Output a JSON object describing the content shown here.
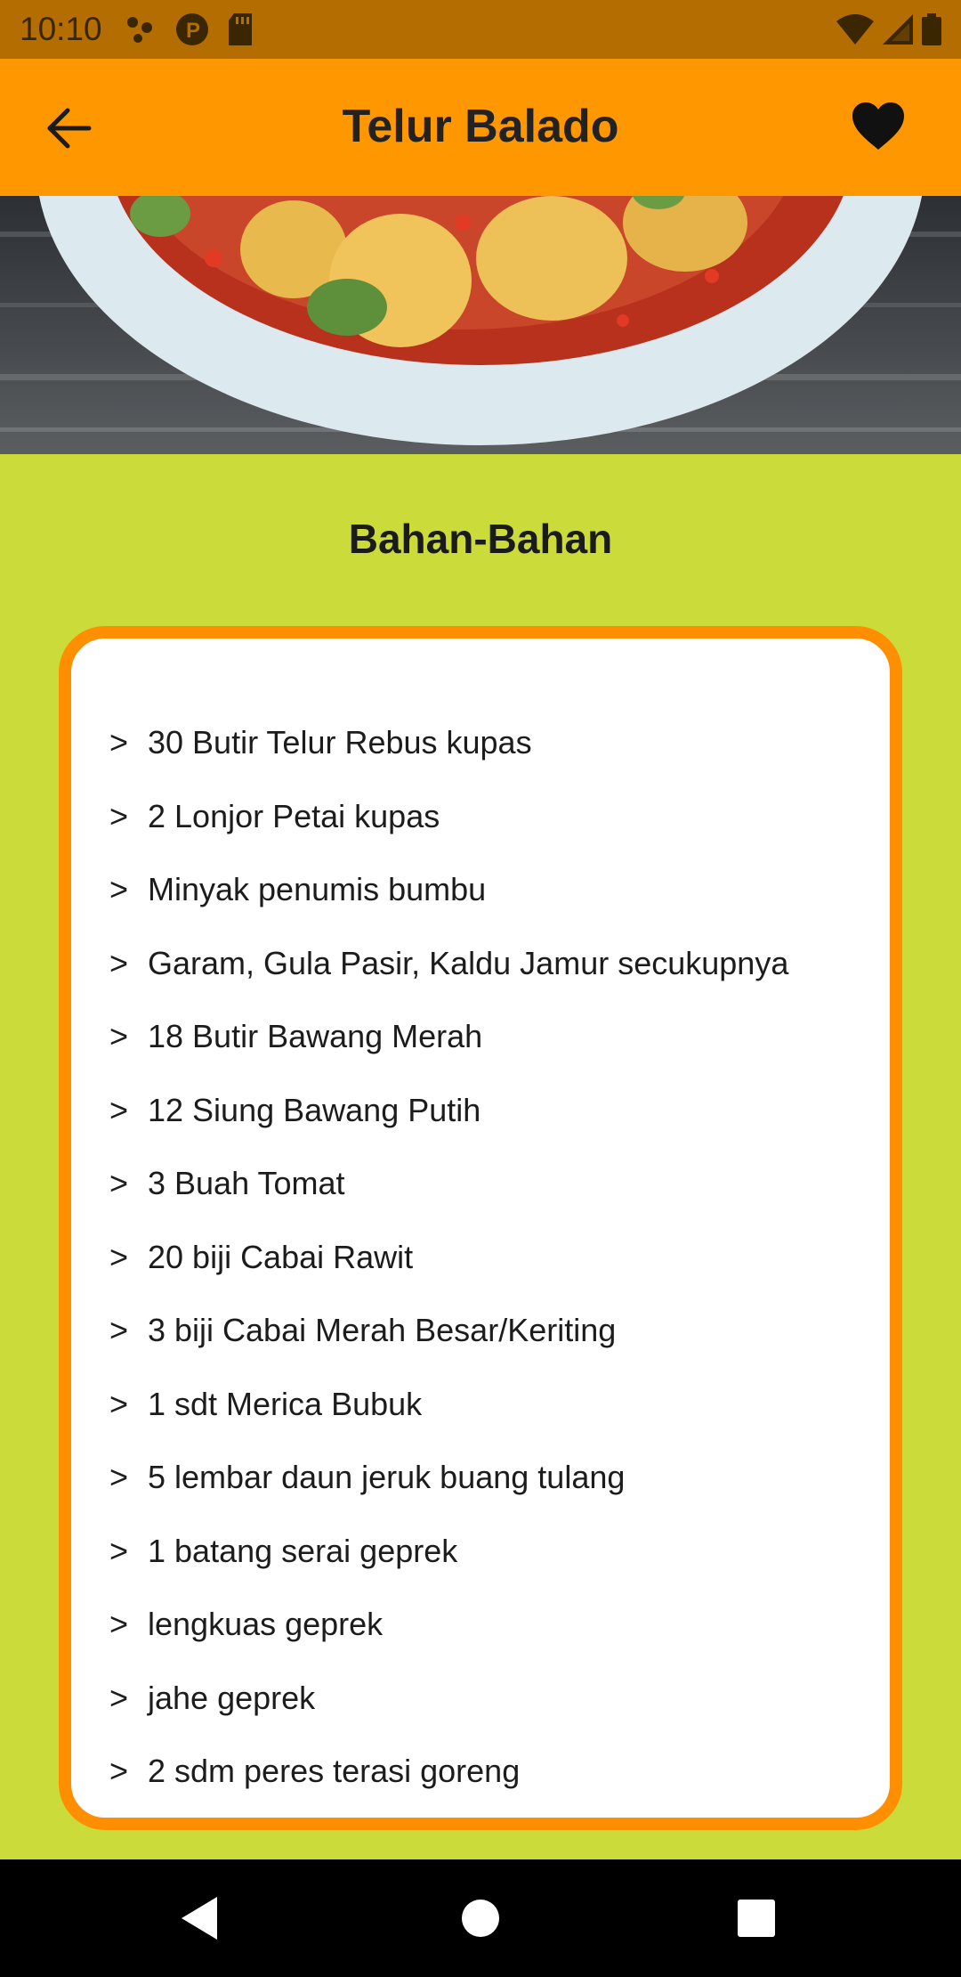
{
  "status_bar": {
    "time": "10:10",
    "left_icons": [
      "connection-dots-icon",
      "p-circle-icon",
      "sd-card-icon"
    ],
    "right_icons": [
      "wifi-icon",
      "cell-signal-icon",
      "battery-icon"
    ]
  },
  "app_bar": {
    "title": "Telur Balado",
    "back_icon": "arrow-left-icon",
    "favorite_icon": "heart-icon"
  },
  "hero_image": {
    "description_icon": "food-photo"
  },
  "ingredients": {
    "heading": "Bahan-Bahan",
    "marker": ">",
    "items": [
      "30 Butir Telur Rebus kupas",
      "2 Lonjor Petai kupas",
      "Minyak penumis bumbu",
      "Garam, Gula Pasir, Kaldu Jamur secukupnya",
      "18 Butir Bawang Merah",
      "12 Siung Bawang Putih",
      "3 Buah Tomat",
      "20 biji Cabai Rawit",
      "3 biji Cabai Merah Besar/Keriting",
      "1 sdt Merica Bubuk",
      "5 lembar daun jeruk buang tulang",
      "1 batang serai geprek",
      "lengkuas geprek",
      "jahe geprek",
      "2 sdm peres terasi goreng"
    ]
  },
  "nav_bar": {
    "buttons": [
      "back-triangle-icon",
      "home-circle-icon",
      "recents-square-icon"
    ]
  },
  "colors": {
    "app_bar": "#ff9800",
    "status_bar": "#b36d00",
    "background": "#cbdc3a",
    "card_border": "#ff8f00"
  }
}
